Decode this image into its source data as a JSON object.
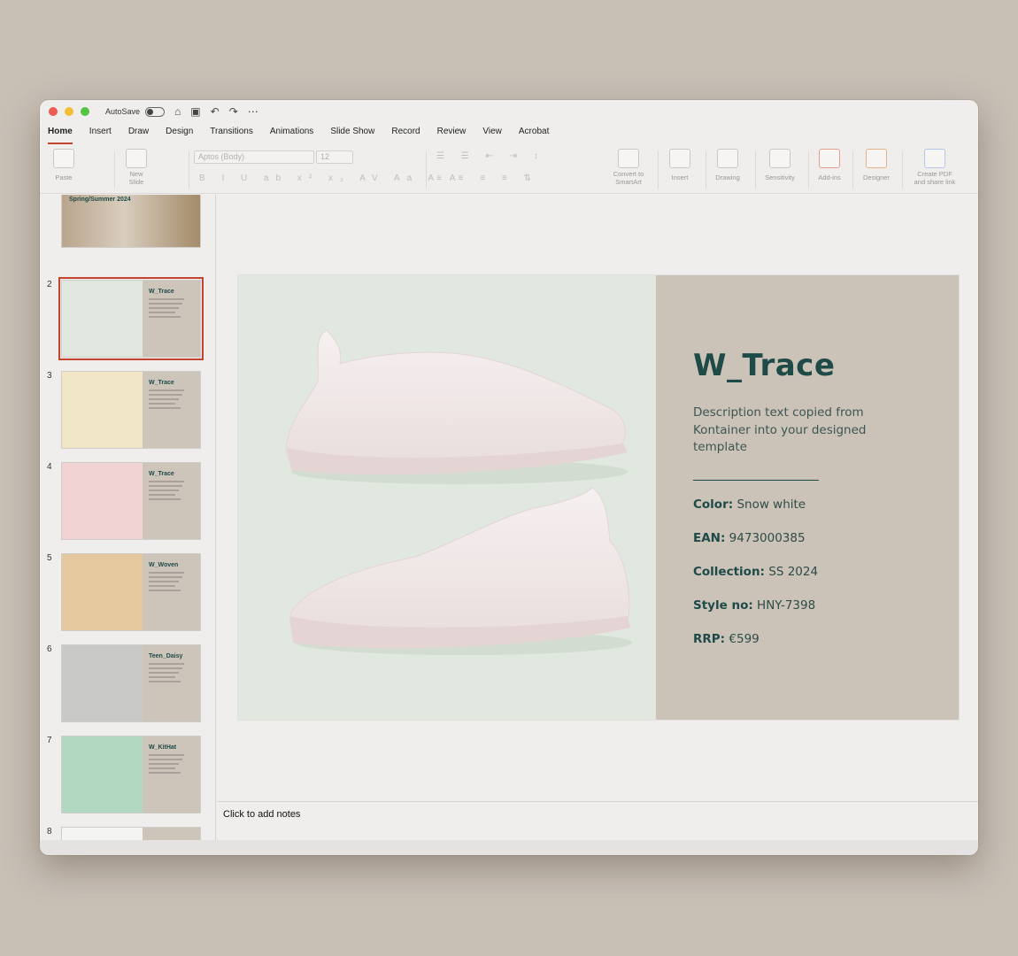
{
  "titlebar": {
    "autosave_label": "AutoSave"
  },
  "tabs": [
    "Home",
    "Insert",
    "Draw",
    "Design",
    "Transitions",
    "Animations",
    "Slide Show",
    "Record",
    "Review",
    "View",
    "Acrobat"
  ],
  "ribbon": {
    "paste": "Paste",
    "new_slide": "New\nSlide",
    "font_name": "Aptos (Body)",
    "font_size": "12",
    "convert": "Convert to\nSmartArt",
    "insert": "Insert",
    "drawing": "Drawing",
    "sensitivity": "Sensitivity",
    "addins": "Add-ins",
    "designer": "Designer",
    "create_pdf": "Create PDF\nand share link"
  },
  "thumbnails": [
    {
      "num": "",
      "title": "Spring/Summer 2024"
    },
    {
      "num": "2",
      "title": "W_Trace"
    },
    {
      "num": "3",
      "title": "W_Trace"
    },
    {
      "num": "4",
      "title": "W_Trace"
    },
    {
      "num": "5",
      "title": "W_Woven"
    },
    {
      "num": "6",
      "title": "Teen_Daisy"
    },
    {
      "num": "7",
      "title": "W_KitHat"
    },
    {
      "num": "8",
      "title": ""
    }
  ],
  "slide": {
    "title": "W_Trace",
    "description": "Description text copied from Kontainer into your designed template",
    "specs": [
      {
        "label": "Color:",
        "value": "Snow white"
      },
      {
        "label": "EAN:",
        "value": "9473000385"
      },
      {
        "label": "Collection:",
        "value": "SS 2024"
      },
      {
        "label": "Style no:",
        "value": "HNY-7398"
      },
      {
        "label": "RRP:",
        "value": "€599"
      }
    ]
  },
  "notes_placeholder": "Click to add notes",
  "colors": {
    "accent": "#c4432e",
    "slide_text": "#1e4a48",
    "slide_panel": "#cbc2b8"
  }
}
